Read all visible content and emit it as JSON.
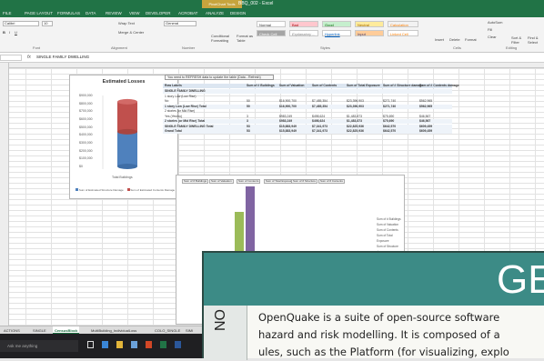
{
  "window": {
    "title": "BBQ_002 - Excel",
    "context_tab": "PivotChart Tools"
  },
  "ribbon_tabs": [
    "FILE",
    "PAGE LAYOUT",
    "FORMULAS",
    "DATA",
    "REVIEW",
    "VIEW",
    "DEVELOPER",
    "ACROBAT",
    "ANALYZE",
    "DESIGN"
  ],
  "ribbon": {
    "font_name": "Calibri",
    "font_size": "10",
    "wrap_text": "Wrap Text",
    "merge_center": "Merge & Center",
    "number_format": "General",
    "conditional_formatting": "Conditional Formatting",
    "format_as_table": "Format as Table",
    "styles": [
      "Normal",
      "Bad",
      "Good",
      "Neutral",
      "Calculation",
      "Check Cell",
      "Explanatory ...",
      "Hyperlink",
      "Input",
      "Linked Cell"
    ],
    "insert": "Insert",
    "delete": "Delete",
    "format": "Format",
    "autosum": "AutoSum",
    "fill": "Fill",
    "clear": "Clear",
    "sort_filter": "Sort & Filter",
    "find_select": "Find & Select",
    "group_labels": [
      "Font",
      "Alignment",
      "Number",
      "Styles",
      "Cells",
      "Editing"
    ]
  },
  "formula_bar": {
    "fx": "fx",
    "value": "SINGLE FAMILY DWELLING"
  },
  "chart1": {
    "title": "Estimated Losses",
    "y_ticks": [
      "$900,000",
      "$800,000",
      "$700,000",
      "$600,000",
      "$500,000",
      "$400,000",
      "$300,000",
      "$200,000",
      "$100,000",
      "$0"
    ],
    "x_label": "Total Buildings",
    "legend": [
      "Sum of Estimated Structure Damage",
      "Sum of Estimated Contents Damage"
    ]
  },
  "chart_data": {
    "type": "bar",
    "title": "Estimated Losses",
    "categories": [
      "Total Buildings"
    ],
    "series": [
      {
        "name": "Sum of Estimated Structure Damage",
        "values": [
          440000
        ]
      },
      {
        "name": "Sum of Estimated Contents Damage",
        "values": [
          380000
        ]
      }
    ],
    "ylim": [
      0,
      900000
    ]
  },
  "pivot": {
    "note": "You need to REFRESH data to update the table (Data - Refresh)",
    "headers": [
      "Row Labels",
      "Sum of # Buildings",
      "Sum of Valuation",
      "Sum of Contents",
      "Sum of Total Exposure",
      "Sum of # Structure damage",
      "Sum of # Contents damage"
    ],
    "rows": [
      [
        "SINGLE FAMILY DWELLING",
        "",
        "",
        "",
        "",
        "",
        ""
      ],
      [
        "1 story Low (Low Rise)",
        "",
        "",
        "",
        "",
        "",
        ""
      ],
      [
        "No",
        "50",
        "$16,900,700",
        "$7,485,354",
        "$23,396,903",
        "$271,740",
        "$562,965"
      ],
      [
        "1 story Low (Low Rise) Total",
        "50",
        "$16,900,700",
        "$7,485,354",
        "$23,396,903",
        "$271,740",
        "$562,965"
      ],
      [
        "2 stories (or Mid Rise)",
        "",
        "",
        "",
        "",
        "",
        ""
      ],
      [
        "Yes (Yes/no)",
        "3",
        "$983,249",
        "$498,624",
        "$1,483,873",
        "$75,690",
        "$46,567"
      ],
      [
        "2 stories (or Mid Rise) Total",
        "3",
        "$983,249",
        "$498,624",
        "$1,483,873",
        "$75,690",
        "$46,567"
      ],
      [
        "SINGLE FAMILY DWELLING Total",
        "53",
        "$15,883,949",
        "$7,341,973",
        "$22,825,936",
        "$642,570",
        "$609,459"
      ],
      [
        "Grand Total",
        "53",
        "$15,883,949",
        "$7,341,973",
        "$22,825,936",
        "$642,570",
        "$609,459"
      ]
    ]
  },
  "chart2": {
    "buttons": [
      "Sum of # Buildings",
      "Sum of Valuation",
      "Sum of Contents",
      "Sum of Total Exposure",
      "Sum of # Structure",
      "Sum of # Contents"
    ],
    "legend": [
      "Sum of # Buildings",
      "Sum of Valuation",
      "Sum of Contents",
      "Sum of Total Exposure",
      "Sum of Structure damage",
      "Sum of Contents damage"
    ]
  },
  "sheet_tabs": [
    "ACTIONS",
    "SINGLE",
    "CensusBlock",
    "MultiBuilding_IndividualLoss",
    "COLO_SINGLE",
    "SIMI"
  ],
  "active_sheet": "CensusBlock",
  "taskbar": {
    "search_placeholder": "Ask me anything"
  },
  "overlay": {
    "title": "GE",
    "side_label": "NO",
    "body_lines": [
      "OpenQuake is a suite of open-source software",
      "hazard and risk modelling. It is composed of a",
      "ules, such as the Platform (for visualizing, explo"
    ]
  },
  "colors": {
    "excel_green": "#217346",
    "overlay_teal": "#3c8b86",
    "bar_red": "#c0504d",
    "bar_blue": "#4f81bd",
    "bar_purple": "#8064a2",
    "bar_green": "#9bbb59"
  }
}
